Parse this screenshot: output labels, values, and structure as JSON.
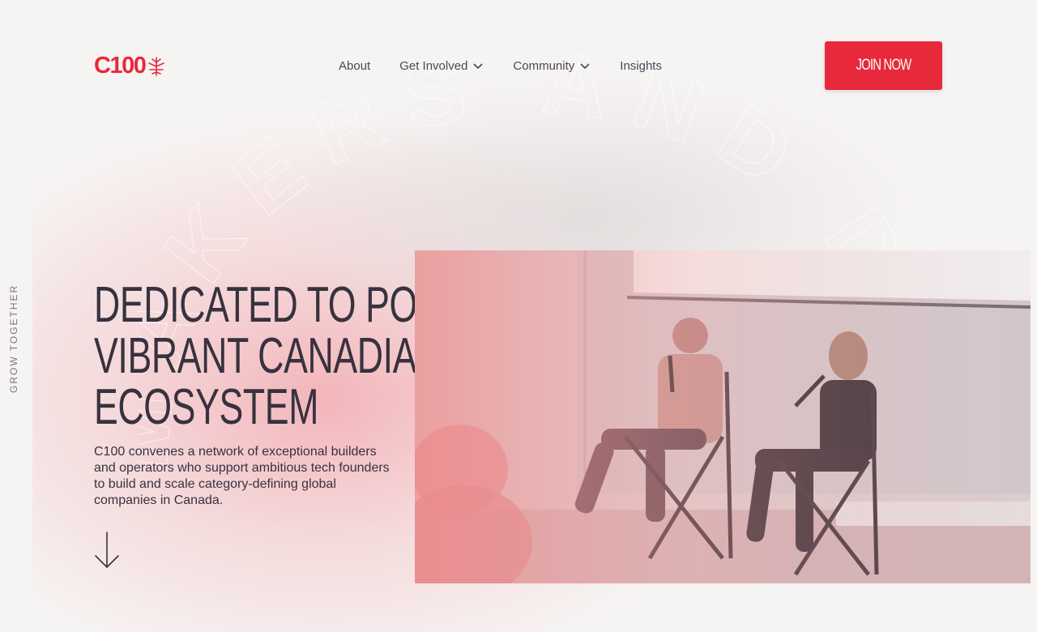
{
  "brand": {
    "logo_text": "C100",
    "accent_color": "#e8293b"
  },
  "nav": {
    "items": [
      {
        "label": "About",
        "has_dropdown": false
      },
      {
        "label": "Get Involved",
        "has_dropdown": true
      },
      {
        "label": "Community",
        "has_dropdown": true
      },
      {
        "label": "Insights",
        "has_dropdown": false
      }
    ],
    "cta_label": "JOIN NOW"
  },
  "background_text": "MAKERS AND DOERS",
  "side_label": "GROW TOGETHER",
  "hero": {
    "title_lines": [
      "DEDICATED TO POWERING A",
      "VIBRANT CANADIAN TECH",
      "ECOSYSTEM"
    ],
    "description": "C100 convenes a network of exceptional builders and operators who support ambitious tech founders to build and scale category-defining global companies in Canada.",
    "scroll_icon": "arrow-down-icon"
  },
  "photo": {
    "subject": "two speakers seated on stage with microphones"
  }
}
